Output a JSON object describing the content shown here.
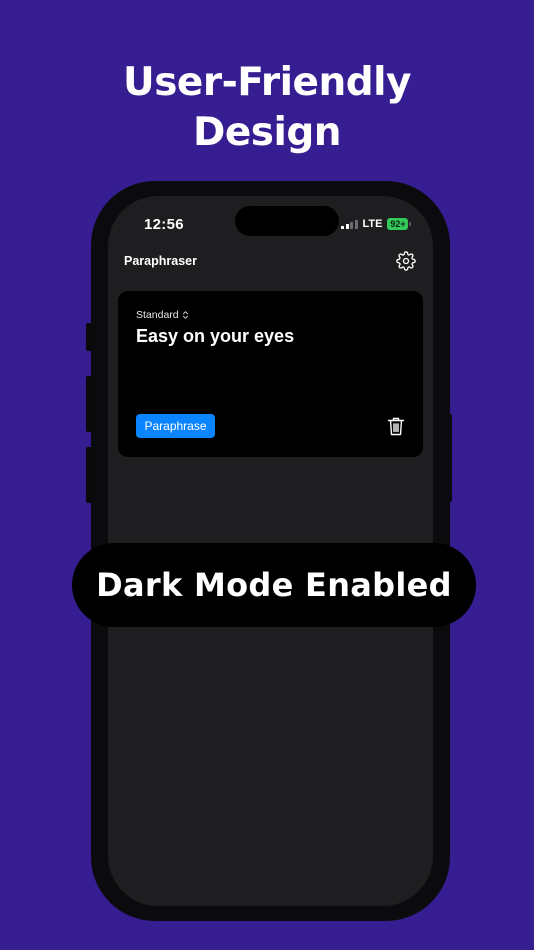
{
  "promo": {
    "headline_line1": "User-Friendly",
    "headline_line2": "Design",
    "banner": "Dark Mode Enabled",
    "background_color": "#361d91"
  },
  "status_bar": {
    "time": "12:56",
    "network": "LTE",
    "battery": "92+",
    "battery_color": "#34c759",
    "signal_icon": "cellular-signal-icon"
  },
  "app": {
    "title": "Paraphraser",
    "settings_icon": "gear-icon",
    "editor": {
      "mode": "Standard",
      "mode_icon": "chevron-updown-icon",
      "text": "Easy on your eyes",
      "paraphrase_label": "Paraphrase",
      "paraphrase_color": "#0a84ff",
      "delete_icon": "trash-icon"
    }
  }
}
